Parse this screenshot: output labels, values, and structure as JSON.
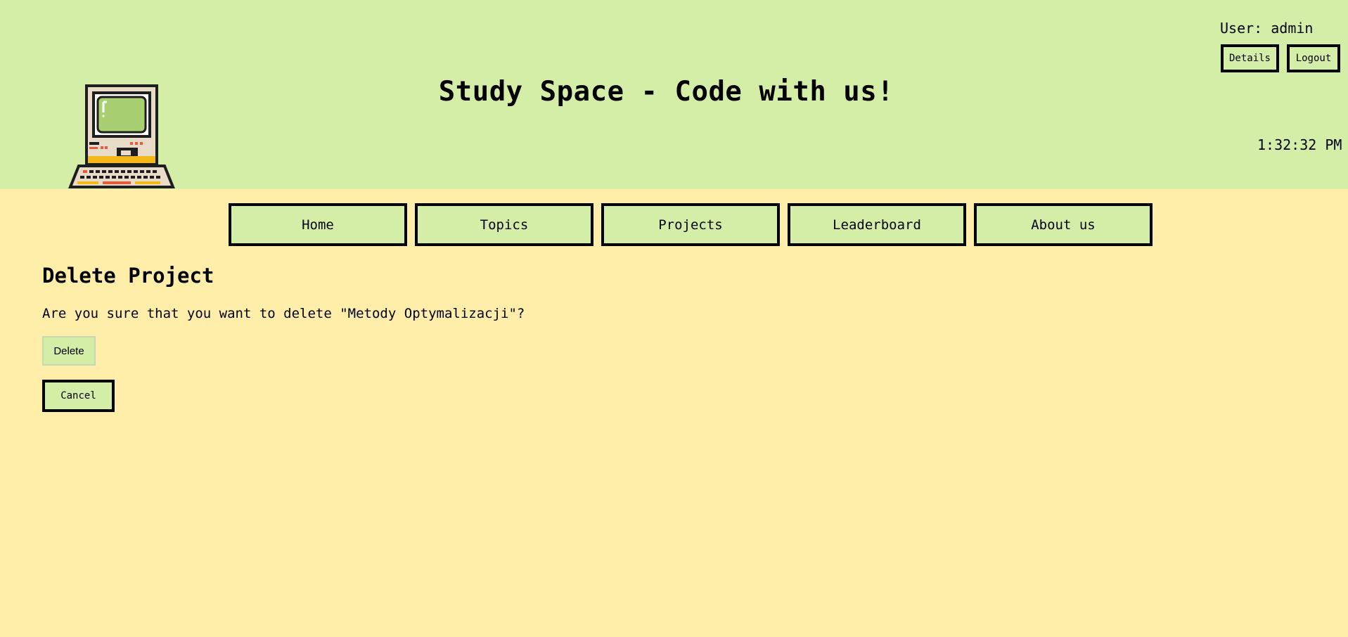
{
  "header": {
    "title": "Study Space - Code with us!",
    "user_label": "User: admin",
    "details_label": "Details",
    "logout_label": "Logout",
    "clock": "1:32:32 PM",
    "logo_icon": "retro-computer-icon"
  },
  "nav": {
    "items": [
      {
        "label": "Home"
      },
      {
        "label": "Topics"
      },
      {
        "label": "Projects"
      },
      {
        "label": "Leaderboard"
      },
      {
        "label": "About us"
      }
    ]
  },
  "main": {
    "title": "Delete Project",
    "confirm_text": "Are you sure that you want to delete \"Metody Optymalizacji\"?",
    "delete_label": "Delete",
    "cancel_label": "Cancel"
  },
  "colors": {
    "header_bg": "#d4eea8",
    "page_bg": "#ffeeaa",
    "button_bg": "#d4eea8",
    "border": "#000000"
  }
}
